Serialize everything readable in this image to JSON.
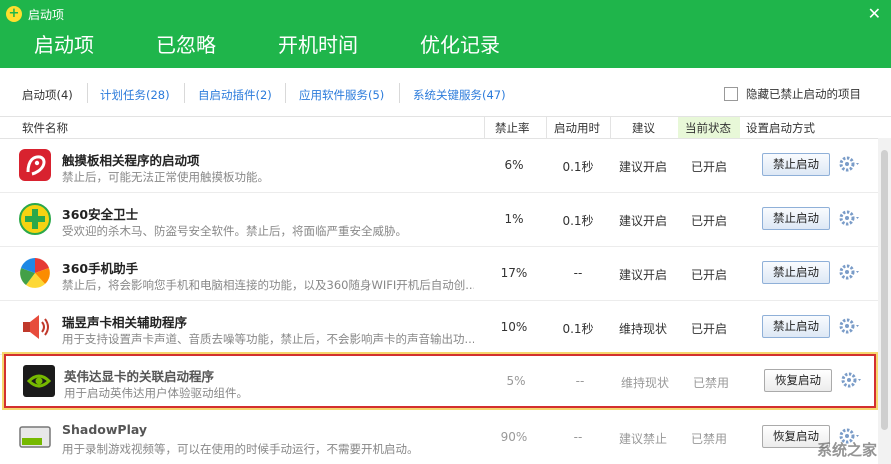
{
  "window": {
    "title": "启动项",
    "close_glyph": "✕"
  },
  "main_tabs": [
    {
      "label": "启动项",
      "active": true
    },
    {
      "label": "已忽略"
    },
    {
      "label": "开机时间"
    },
    {
      "label": "优化记录"
    }
  ],
  "sub_tabs": [
    {
      "label": "启动项(4)"
    },
    {
      "label": "计划任务(28)"
    },
    {
      "label": "自启动插件(2)"
    },
    {
      "label": "应用软件服务(5)"
    },
    {
      "label": "系统关键服务(47)"
    }
  ],
  "hide_disabled_label": "隐藏已禁止启动的项目",
  "columns": {
    "name": "软件名称",
    "rate": "禁止率",
    "time": "启动用时",
    "suggest": "建议",
    "state": "当前状态",
    "method": "设置启动方式"
  },
  "rows": [
    {
      "icon": "touchpad-app-icon",
      "name": "触摸板相关程序的启动项",
      "desc": "禁止后，可能无法正常使用触摸板功能。",
      "rate": "6%",
      "time": "0.1秒",
      "suggest": "建议开启",
      "state": "已开启",
      "button": "禁止启动"
    },
    {
      "icon": "360-safe-icon",
      "name": "360安全卫士",
      "desc": "受欢迎的杀木马、防盗号安全软件。禁止后，将面临严重安全威胁。",
      "rate": "1%",
      "time": "0.1秒",
      "suggest": "建议开启",
      "state": "已开启",
      "button": "禁止启动"
    },
    {
      "icon": "360-mobile-assistant-icon",
      "name": "360手机助手",
      "desc": "禁止后，将会影响您手机和电脑相连接的功能，以及360随身WIFI开机后自动创...",
      "rate": "17%",
      "time": "--",
      "suggest": "建议开启",
      "state": "已开启",
      "button": "禁止启动"
    },
    {
      "icon": "speaker-icon",
      "name": "瑞昱声卡相关辅助程序",
      "desc": "用于支持设置声卡声道、音质去噪等功能，禁止后，不会影响声卡的声音输出功...",
      "rate": "10%",
      "time": "0.1秒",
      "suggest": "维持现状",
      "state": "已开启",
      "button": "禁止启动"
    },
    {
      "icon": "nvidia-icon",
      "name": "英伟达显卡的关联启动程序",
      "desc": "用于启动英伟达用户体验驱动组件。",
      "rate": "5%",
      "time": "--",
      "suggest": "维持现状",
      "state": "已禁用",
      "button": "恢复启动"
    },
    {
      "icon": "shadowplay-icon",
      "name": "ShadowPlay",
      "desc": "用于录制游戏视频等，可以在使用的时候手动运行，不需要开机启动。",
      "rate": "90%",
      "time": "--",
      "suggest": "建议禁止",
      "state": "已禁用",
      "button": "恢复启动"
    }
  ],
  "watermark": "系统之家",
  "colors": {
    "header_green": "#1fb54b",
    "link_blue": "#2b7bdb",
    "highlight_red": "#d32f2f",
    "highlight_yellow": "#f5d76e"
  }
}
